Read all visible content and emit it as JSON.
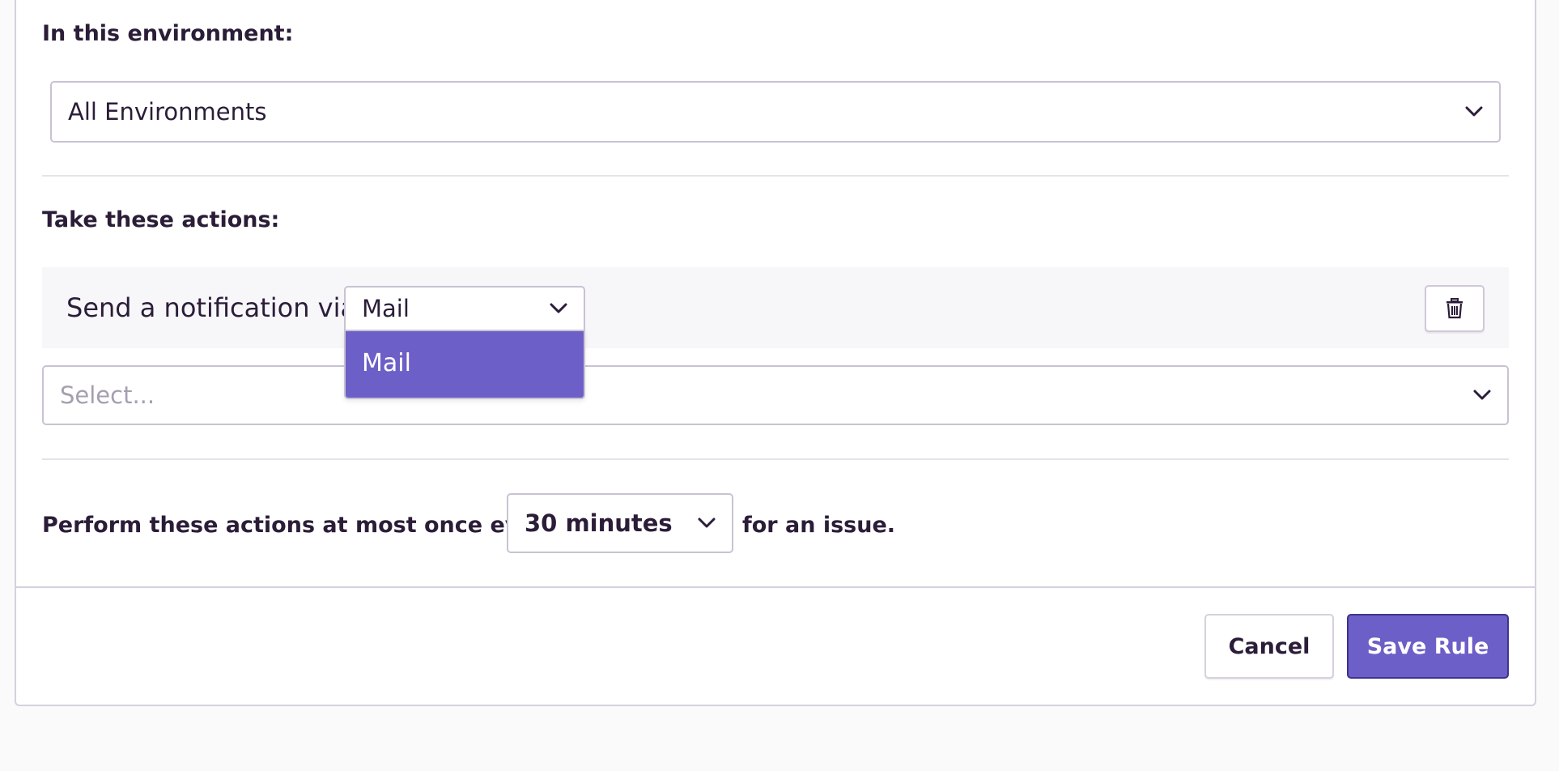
{
  "environment": {
    "heading": "In this environment:",
    "selected": "All Environments"
  },
  "actions": {
    "heading": "Take these actions:",
    "notify_label": "Send a notification via",
    "notify_selected": "Mail",
    "notify_options": [
      "Mail"
    ],
    "secondary_placeholder": "Select..."
  },
  "frequency": {
    "prefix": "Perform these actions at most once every",
    "selected": "30 minutes",
    "suffix": "for an issue."
  },
  "buttons": {
    "cancel": "Cancel",
    "save": "Save Rule"
  },
  "colors": {
    "accent": "#6c5fc7",
    "text": "#2b1d38",
    "border": "#c9c2d3"
  },
  "icons": {
    "delete": "trash-icon",
    "dropdown": "chevron-down-icon"
  }
}
